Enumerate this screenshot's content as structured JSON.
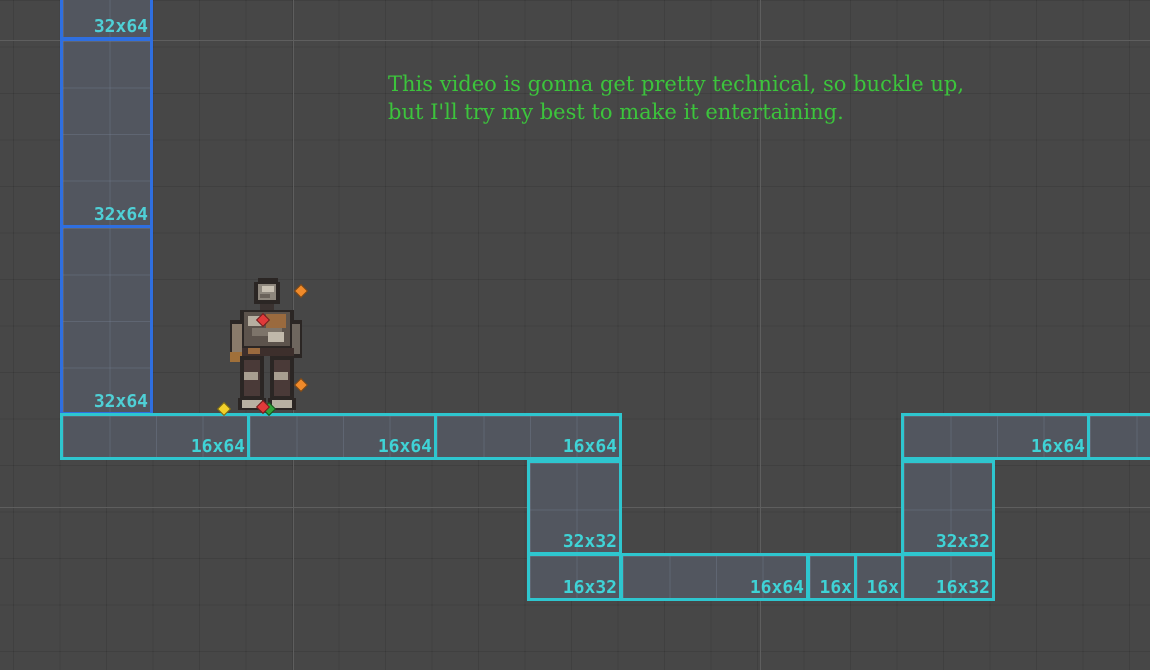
{
  "scene": {
    "caption_line1": "This video is gonna get pretty technical, so buckle up,",
    "caption_line2": "but I'll try my best to make it entertaining.",
    "colors": {
      "background": "#474747",
      "tile_fill": "#52565f",
      "wall_border": "#2f6fe0",
      "ground_border": "#2ec6cf",
      "label_text": "#3fd3d6",
      "caption_text": "#3cc43c"
    }
  },
  "tiles": {
    "wall_top": "32x64",
    "wall_mid": "32x64",
    "wall_bottom": "32x64",
    "ground_1": "16x64",
    "ground_2": "16x64",
    "ground_3": "16x64",
    "pit_left_upper": "32x32",
    "pit_left_lower": "16x32",
    "pit_floor_long": "16x64",
    "pit_floor_small_1": "16x",
    "pit_floor_small_2": "16x",
    "pit_right_lower": "16x32",
    "pit_right_upper": "32x32",
    "ground_right": "16x64"
  },
  "player": {
    "sprite": "armored-knight-sprite",
    "markers": [
      "orange-diamond-icon",
      "red-diamond-icon",
      "orange-diamond-icon",
      "yellow-diamond-icon",
      "red-diamond-icon",
      "green-diamond-icon"
    ]
  }
}
